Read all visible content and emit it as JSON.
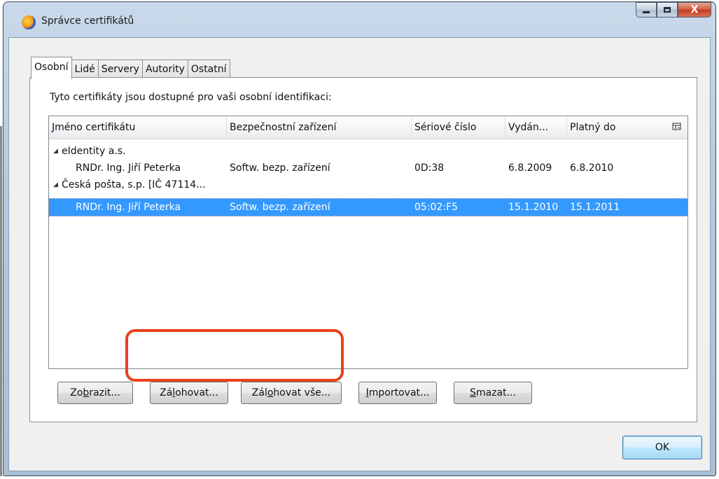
{
  "window": {
    "title": "Správce certifikátů",
    "icon": "firefox-icon",
    "buttons": {
      "minimize": "minimize-icon",
      "maximize": "maximize-icon",
      "close_label": "X"
    }
  },
  "tabs": [
    {
      "label": "Osobní",
      "active": true
    },
    {
      "label": "Lidé",
      "active": false
    },
    {
      "label": "Servery",
      "active": false
    },
    {
      "label": "Autority",
      "active": false
    },
    {
      "label": "Ostatní",
      "active": false
    }
  ],
  "panel": {
    "intro": "Tyto certifikáty jsou dostupné pro vaši osobní identifikaci:"
  },
  "tree": {
    "columns": [
      "Jméno certifikátu",
      "Bezpečnostní zařízení",
      "Sériové číslo",
      "Vydán...",
      "Platný do"
    ],
    "column_picker_icon": "column-picker-icon",
    "groups": [
      {
        "name": "eIdentity a.s.",
        "rows": [
          {
            "name": "RNDr. Ing. Jiří Peterka",
            "device": "Softw. bezp. zařízení",
            "serial": "0D:38",
            "issued": "6.8.2009",
            "expires": "6.8.2010",
            "selected": false
          }
        ]
      },
      {
        "name": "Česká pošta, s.p. [IČ 47114...",
        "rows": [
          {
            "name": "RNDr. Ing. Jiří Peterka",
            "device": "Softw. bezp. zařízení",
            "serial": "05:02:F5",
            "issued": "15.1.2010",
            "expires": "15.1.2011",
            "selected": true
          }
        ]
      }
    ]
  },
  "actions": {
    "view": {
      "prefix": "Zo",
      "accel": "b",
      "suffix": "razit..."
    },
    "backup": {
      "prefix": "Zá",
      "accel": "l",
      "suffix": "ohovat..."
    },
    "backup_all": {
      "prefix": "Zál",
      "accel": "o",
      "suffix": "hovat vše..."
    },
    "import": {
      "prefix": "",
      "accel": "I",
      "suffix": "mportovat..."
    },
    "delete": {
      "prefix": "",
      "accel": "S",
      "suffix": "mazat..."
    }
  },
  "ok_label": "OK",
  "colors": {
    "selection": "#3399ff",
    "highlight_annotation": "#e8401c"
  }
}
